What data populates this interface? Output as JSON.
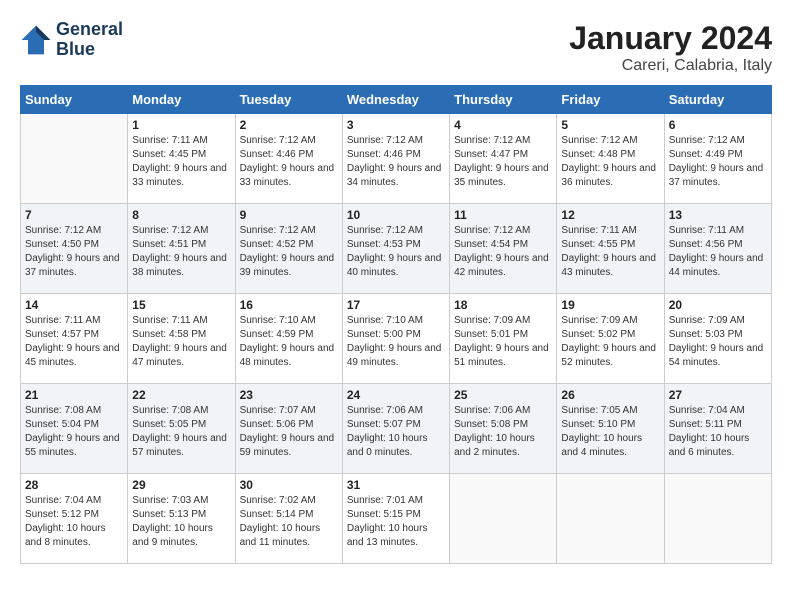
{
  "header": {
    "logo_line1": "General",
    "logo_line2": "Blue",
    "month_title": "January 2024",
    "location": "Careri, Calabria, Italy"
  },
  "weekdays": [
    "Sunday",
    "Monday",
    "Tuesday",
    "Wednesday",
    "Thursday",
    "Friday",
    "Saturday"
  ],
  "weeks": [
    [
      {
        "day": "",
        "sunrise": "",
        "sunset": "",
        "daylight": ""
      },
      {
        "day": "1",
        "sunrise": "Sunrise: 7:11 AM",
        "sunset": "Sunset: 4:45 PM",
        "daylight": "Daylight: 9 hours and 33 minutes."
      },
      {
        "day": "2",
        "sunrise": "Sunrise: 7:12 AM",
        "sunset": "Sunset: 4:46 PM",
        "daylight": "Daylight: 9 hours and 33 minutes."
      },
      {
        "day": "3",
        "sunrise": "Sunrise: 7:12 AM",
        "sunset": "Sunset: 4:46 PM",
        "daylight": "Daylight: 9 hours and 34 minutes."
      },
      {
        "day": "4",
        "sunrise": "Sunrise: 7:12 AM",
        "sunset": "Sunset: 4:47 PM",
        "daylight": "Daylight: 9 hours and 35 minutes."
      },
      {
        "day": "5",
        "sunrise": "Sunrise: 7:12 AM",
        "sunset": "Sunset: 4:48 PM",
        "daylight": "Daylight: 9 hours and 36 minutes."
      },
      {
        "day": "6",
        "sunrise": "Sunrise: 7:12 AM",
        "sunset": "Sunset: 4:49 PM",
        "daylight": "Daylight: 9 hours and 37 minutes."
      }
    ],
    [
      {
        "day": "7",
        "sunrise": "Sunrise: 7:12 AM",
        "sunset": "Sunset: 4:50 PM",
        "daylight": "Daylight: 9 hours and 37 minutes."
      },
      {
        "day": "8",
        "sunrise": "Sunrise: 7:12 AM",
        "sunset": "Sunset: 4:51 PM",
        "daylight": "Daylight: 9 hours and 38 minutes."
      },
      {
        "day": "9",
        "sunrise": "Sunrise: 7:12 AM",
        "sunset": "Sunset: 4:52 PM",
        "daylight": "Daylight: 9 hours and 39 minutes."
      },
      {
        "day": "10",
        "sunrise": "Sunrise: 7:12 AM",
        "sunset": "Sunset: 4:53 PM",
        "daylight": "Daylight: 9 hours and 40 minutes."
      },
      {
        "day": "11",
        "sunrise": "Sunrise: 7:12 AM",
        "sunset": "Sunset: 4:54 PM",
        "daylight": "Daylight: 9 hours and 42 minutes."
      },
      {
        "day": "12",
        "sunrise": "Sunrise: 7:11 AM",
        "sunset": "Sunset: 4:55 PM",
        "daylight": "Daylight: 9 hours and 43 minutes."
      },
      {
        "day": "13",
        "sunrise": "Sunrise: 7:11 AM",
        "sunset": "Sunset: 4:56 PM",
        "daylight": "Daylight: 9 hours and 44 minutes."
      }
    ],
    [
      {
        "day": "14",
        "sunrise": "Sunrise: 7:11 AM",
        "sunset": "Sunset: 4:57 PM",
        "daylight": "Daylight: 9 hours and 45 minutes."
      },
      {
        "day": "15",
        "sunrise": "Sunrise: 7:11 AM",
        "sunset": "Sunset: 4:58 PM",
        "daylight": "Daylight: 9 hours and 47 minutes."
      },
      {
        "day": "16",
        "sunrise": "Sunrise: 7:10 AM",
        "sunset": "Sunset: 4:59 PM",
        "daylight": "Daylight: 9 hours and 48 minutes."
      },
      {
        "day": "17",
        "sunrise": "Sunrise: 7:10 AM",
        "sunset": "Sunset: 5:00 PM",
        "daylight": "Daylight: 9 hours and 49 minutes."
      },
      {
        "day": "18",
        "sunrise": "Sunrise: 7:09 AM",
        "sunset": "Sunset: 5:01 PM",
        "daylight": "Daylight: 9 hours and 51 minutes."
      },
      {
        "day": "19",
        "sunrise": "Sunrise: 7:09 AM",
        "sunset": "Sunset: 5:02 PM",
        "daylight": "Daylight: 9 hours and 52 minutes."
      },
      {
        "day": "20",
        "sunrise": "Sunrise: 7:09 AM",
        "sunset": "Sunset: 5:03 PM",
        "daylight": "Daylight: 9 hours and 54 minutes."
      }
    ],
    [
      {
        "day": "21",
        "sunrise": "Sunrise: 7:08 AM",
        "sunset": "Sunset: 5:04 PM",
        "daylight": "Daylight: 9 hours and 55 minutes."
      },
      {
        "day": "22",
        "sunrise": "Sunrise: 7:08 AM",
        "sunset": "Sunset: 5:05 PM",
        "daylight": "Daylight: 9 hours and 57 minutes."
      },
      {
        "day": "23",
        "sunrise": "Sunrise: 7:07 AM",
        "sunset": "Sunset: 5:06 PM",
        "daylight": "Daylight: 9 hours and 59 minutes."
      },
      {
        "day": "24",
        "sunrise": "Sunrise: 7:06 AM",
        "sunset": "Sunset: 5:07 PM",
        "daylight": "Daylight: 10 hours and 0 minutes."
      },
      {
        "day": "25",
        "sunrise": "Sunrise: 7:06 AM",
        "sunset": "Sunset: 5:08 PM",
        "daylight": "Daylight: 10 hours and 2 minutes."
      },
      {
        "day": "26",
        "sunrise": "Sunrise: 7:05 AM",
        "sunset": "Sunset: 5:10 PM",
        "daylight": "Daylight: 10 hours and 4 minutes."
      },
      {
        "day": "27",
        "sunrise": "Sunrise: 7:04 AM",
        "sunset": "Sunset: 5:11 PM",
        "daylight": "Daylight: 10 hours and 6 minutes."
      }
    ],
    [
      {
        "day": "28",
        "sunrise": "Sunrise: 7:04 AM",
        "sunset": "Sunset: 5:12 PM",
        "daylight": "Daylight: 10 hours and 8 minutes."
      },
      {
        "day": "29",
        "sunrise": "Sunrise: 7:03 AM",
        "sunset": "Sunset: 5:13 PM",
        "daylight": "Daylight: 10 hours and 9 minutes."
      },
      {
        "day": "30",
        "sunrise": "Sunrise: 7:02 AM",
        "sunset": "Sunset: 5:14 PM",
        "daylight": "Daylight: 10 hours and 11 minutes."
      },
      {
        "day": "31",
        "sunrise": "Sunrise: 7:01 AM",
        "sunset": "Sunset: 5:15 PM",
        "daylight": "Daylight: 10 hours and 13 minutes."
      },
      {
        "day": "",
        "sunrise": "",
        "sunset": "",
        "daylight": ""
      },
      {
        "day": "",
        "sunrise": "",
        "sunset": "",
        "daylight": ""
      },
      {
        "day": "",
        "sunrise": "",
        "sunset": "",
        "daylight": ""
      }
    ]
  ]
}
